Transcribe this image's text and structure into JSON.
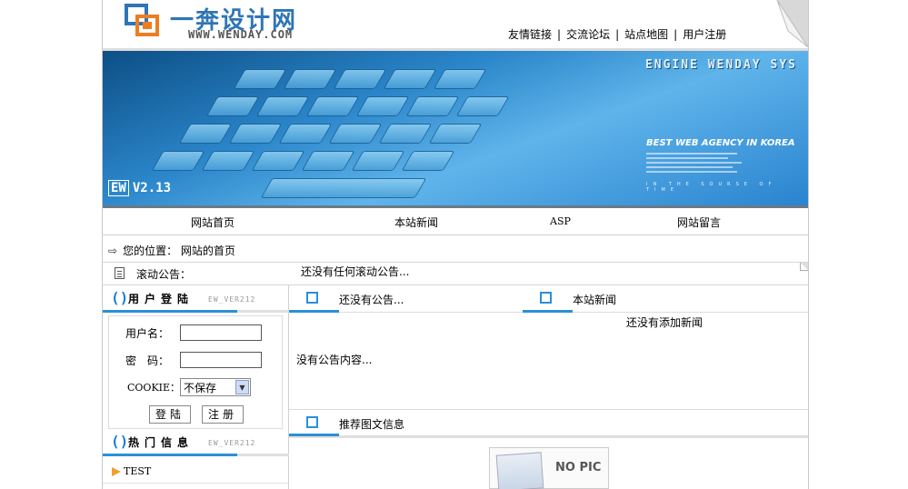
{
  "header": {
    "logo_title": "一奔设计网",
    "logo_url": "WWW.WENDAY.COM",
    "links": [
      "友情链接",
      "交流论坛",
      "站点地图",
      "用户注册"
    ],
    "separator": "|"
  },
  "banner": {
    "title": "ENGINE WENDAY SYS",
    "agency": "BEST WEB AGENCY IN KOREA",
    "course": "IN THE SOURSE OF TIME",
    "ver_badge": "EW",
    "ver": "V2.13"
  },
  "nav": {
    "items": [
      "网站首页",
      "本站新闻",
      "ASP",
      "网站留言"
    ]
  },
  "breadcrumb": {
    "label": "您的位置：",
    "current": "网站的首页"
  },
  "notice": {
    "label": "滚动公告：",
    "text": "还没有任何滚动公告..."
  },
  "login": {
    "title": "用户登陆",
    "ver": "EW_VER212",
    "username_label": "用户名：",
    "password_label": "密　码：",
    "cookie_label": "COOKIE：",
    "cookie_value": "不保存",
    "login_button": "登陆",
    "register_button": "注册"
  },
  "hot": {
    "title": "热门信息",
    "ver": "EW_VER212",
    "items": [
      "TEST"
    ]
  },
  "main": {
    "gongao_tab": "还没有公告...",
    "gongao_body": "没有公告内容...",
    "news_tab": "本站新闻",
    "news_body": "还没有添加新闻",
    "recommend_tab": "推荐图文信息",
    "no_pic": "NO PIC"
  },
  "colors": {
    "accent": "#2a90d8",
    "banner": "#2a85c9"
  }
}
